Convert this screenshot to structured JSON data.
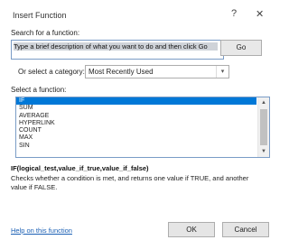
{
  "window": {
    "title": "Insert Function",
    "help_glyph": "?",
    "close_glyph": "✕"
  },
  "search": {
    "label": "Search for a function:",
    "value": "Type a brief description of what you want to do and then click Go",
    "go_label": "Go"
  },
  "category": {
    "label": "Or select a category:",
    "selected": "Most Recently Used",
    "arrow_glyph": "▾"
  },
  "functions": {
    "label": "Select a function:",
    "items": [
      "IF",
      "SUM",
      "AVERAGE",
      "HYPERLINK",
      "COUNT",
      "MAX",
      "SIN"
    ],
    "selected_index": 0,
    "scroll_up_glyph": "▲",
    "scroll_down_glyph": "▼"
  },
  "details": {
    "syntax": "IF(logical_test,value_if_true,value_if_false)",
    "description": "Checks whether a condition is met, and returns one value if TRUE, and another value if FALSE."
  },
  "footer": {
    "help_link": "Help on this function",
    "ok_label": "OK",
    "cancel_label": "Cancel"
  },
  "colors": {
    "selection": "#0078d7",
    "link": "#1a5fb4"
  }
}
